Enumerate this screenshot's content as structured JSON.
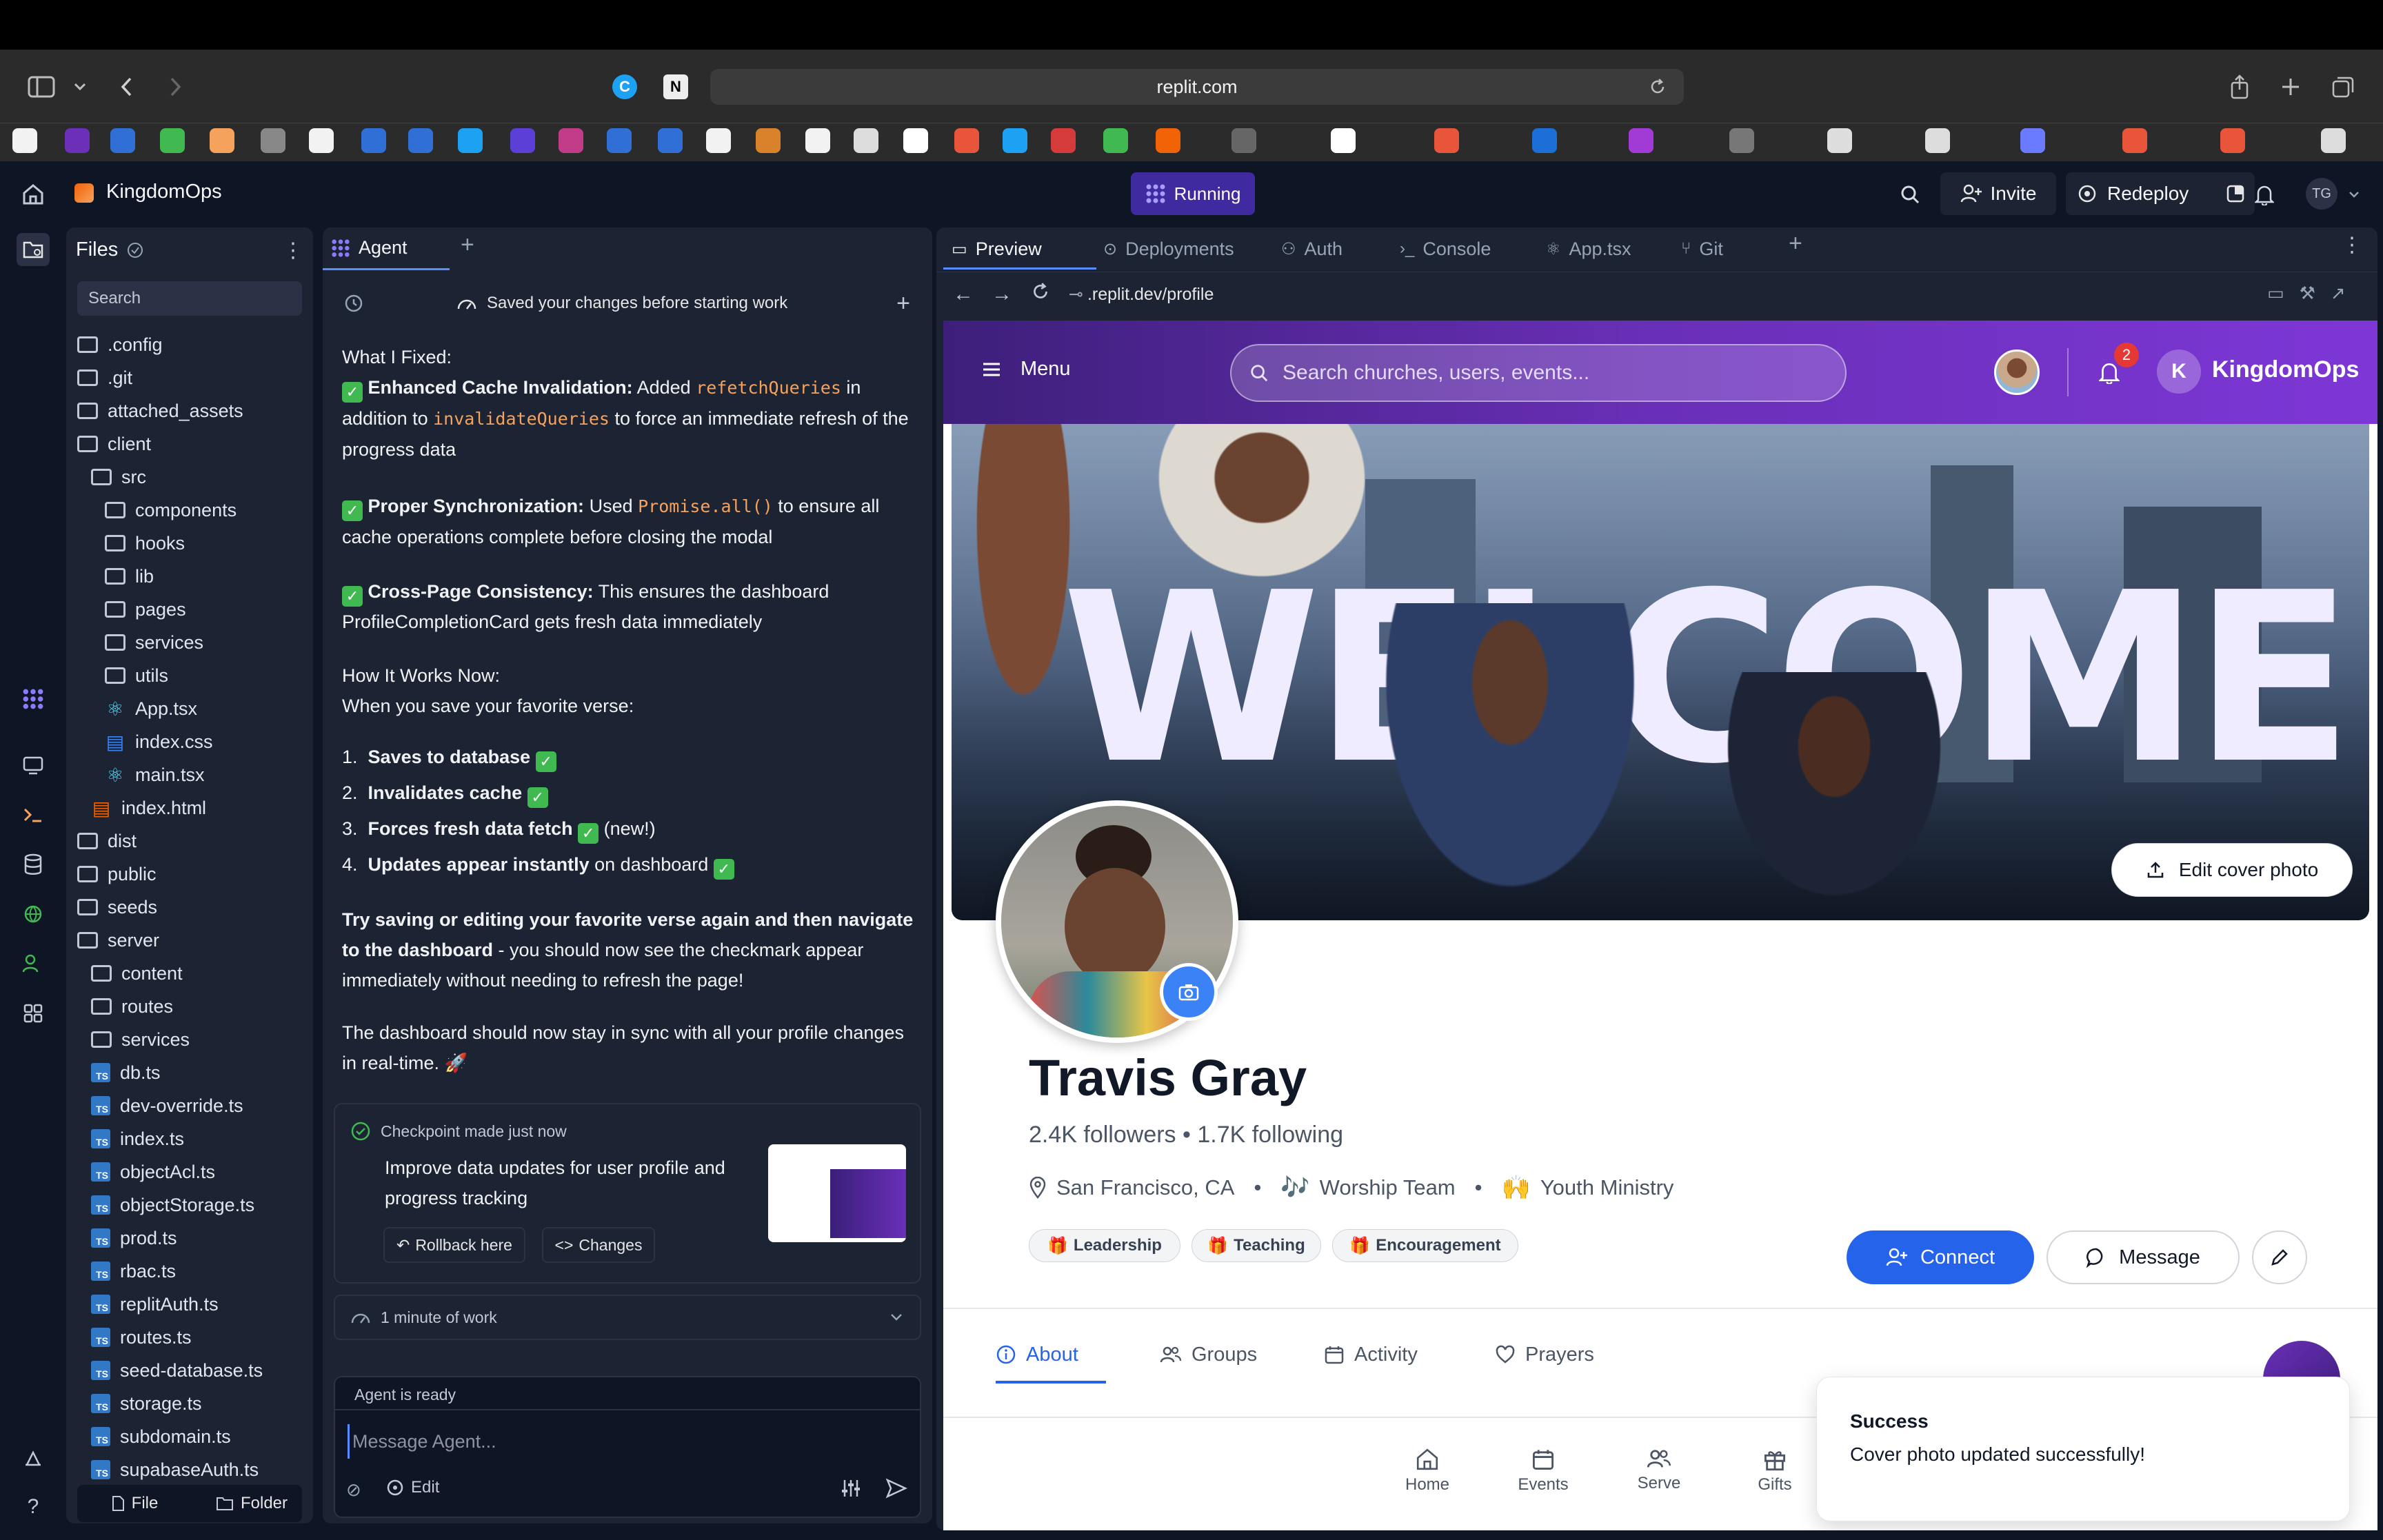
{
  "browser": {
    "url": "replit.com"
  },
  "replit": {
    "repl_name": "KingdomOps",
    "status": "Running",
    "invite_label": "Invite",
    "redeploy_label": "Redeploy",
    "user_initials": "TG"
  },
  "files_panel": {
    "title": "Files",
    "search_placeholder": "Search",
    "items": [
      {
        "name": ".config",
        "type": "folder",
        "depth": 0
      },
      {
        "name": ".git",
        "type": "folder",
        "depth": 0
      },
      {
        "name": "attached_assets",
        "type": "folder",
        "depth": 0
      },
      {
        "name": "client",
        "type": "folder-open",
        "depth": 0
      },
      {
        "name": "src",
        "type": "folder-open",
        "depth": 1
      },
      {
        "name": "components",
        "type": "folder",
        "depth": 2
      },
      {
        "name": "hooks",
        "type": "folder",
        "depth": 2
      },
      {
        "name": "lib",
        "type": "folder",
        "depth": 2
      },
      {
        "name": "pages",
        "type": "folder",
        "depth": 2
      },
      {
        "name": "services",
        "type": "folder",
        "depth": 2
      },
      {
        "name": "utils",
        "type": "folder",
        "depth": 2
      },
      {
        "name": "App.tsx",
        "type": "react",
        "depth": 2
      },
      {
        "name": "index.css",
        "type": "css",
        "depth": 2
      },
      {
        "name": "main.tsx",
        "type": "react",
        "depth": 2
      },
      {
        "name": "index.html",
        "type": "html",
        "depth": 1
      },
      {
        "name": "dist",
        "type": "folder",
        "depth": 0
      },
      {
        "name": "public",
        "type": "folder",
        "depth": 0
      },
      {
        "name": "seeds",
        "type": "folder",
        "depth": 0
      },
      {
        "name": "server",
        "type": "folder-open",
        "depth": 0
      },
      {
        "name": "content",
        "type": "folder",
        "depth": 1
      },
      {
        "name": "routes",
        "type": "folder",
        "depth": 1
      },
      {
        "name": "services",
        "type": "folder",
        "depth": 1
      },
      {
        "name": "db.ts",
        "type": "ts",
        "depth": 1
      },
      {
        "name": "dev-override.ts",
        "type": "ts",
        "depth": 1
      },
      {
        "name": "index.ts",
        "type": "ts",
        "depth": 1
      },
      {
        "name": "objectAcl.ts",
        "type": "ts",
        "depth": 1
      },
      {
        "name": "objectStorage.ts",
        "type": "ts",
        "depth": 1
      },
      {
        "name": "prod.ts",
        "type": "ts",
        "depth": 1
      },
      {
        "name": "rbac.ts",
        "type": "ts",
        "depth": 1
      },
      {
        "name": "replitAuth.ts",
        "type": "ts",
        "depth": 1
      },
      {
        "name": "routes.ts",
        "type": "ts",
        "depth": 1
      },
      {
        "name": "seed-database.ts",
        "type": "ts",
        "depth": 1
      },
      {
        "name": "storage.ts",
        "type": "ts",
        "depth": 1
      },
      {
        "name": "subdomain.ts",
        "type": "ts",
        "depth": 1
      },
      {
        "name": "supabaseAuth.ts",
        "type": "ts",
        "depth": 1
      }
    ],
    "file_button": "File",
    "folder_button": "Folder"
  },
  "agent": {
    "tab_label": "Agent",
    "saved_banner": "Saved your changes before starting work",
    "heading_fixed": "What I Fixed:",
    "p1_bold": "Enhanced Cache Invalidation:",
    "p1_a": " Added ",
    "p1_code1": "refetchQueries",
    "p1_b": " in addition to ",
    "p1_code2": "invalidateQueries",
    "p1_c": " to force an immediate refresh of the progress data",
    "p2_bold": "Proper Synchronization:",
    "p2_a": " Used ",
    "p2_code": "Promise.all()",
    "p2_b": " to ensure all cache operations complete before closing the modal",
    "p3_bold": "Cross-Page Consistency:",
    "p3_a": " This ensures the dashboard ProfileCompletionCard gets fresh data immediately",
    "how_heading": "How It Works Now:",
    "how_sub": "When you save your favorite verse:",
    "step1": "Saves to database",
    "step2": "Invalidates cache",
    "step3": "Forces fresh data fetch",
    "step3_suffix": "(new!)",
    "step4": "Updates appear instantly",
    "step4_suffix": "on dashboard",
    "try_bold": "Try saving or editing your favorite verse again and then navigate to the dashboard",
    "try_rest": " - you should now see the checkmark appear immediately without needing to refresh the page!",
    "closing": "The dashboard should now stay in sync with all your profile changes in real-time. 🚀",
    "checkpoint_title": "Checkpoint made just now",
    "checkpoint_desc": "Improve data updates for user profile and progress tracking",
    "rollback_label": "Rollback here",
    "changes_label": "Changes",
    "work_time": "1 minute of work",
    "ready_label": "Agent is ready",
    "input_placeholder": "Message Agent...",
    "edit_label": "Edit"
  },
  "preview_tabs": {
    "tabs": [
      "Preview",
      "Deployments",
      "Auth",
      "Console",
      "App.tsx",
      "Git"
    ],
    "url": ".replit.dev/profile"
  },
  "app": {
    "menu_label": "Menu",
    "search_placeholder": "Search churches, users, events...",
    "notification_count": "2",
    "brand_initial": "K",
    "brand_name": "KingdomOps",
    "cover_word": "WELCOME",
    "edit_cover_label": "Edit cover photo",
    "profile": {
      "name": "Travis Gray",
      "followers": "2.4K followers • 1.7K following",
      "location": "San Francisco, CA",
      "team": "Worship Team",
      "ministry": "Youth Ministry",
      "chips": [
        "Leadership",
        "Teaching",
        "Encouragement"
      ]
    },
    "connect_label": "Connect",
    "message_label": "Message",
    "tabs": [
      "About",
      "Groups",
      "Activity",
      "Prayers"
    ],
    "bottom_nav": [
      "Home",
      "Events",
      "Serve",
      "Gifts"
    ],
    "toast": {
      "title": "Success",
      "message": "Cover photo updated successfully!"
    }
  },
  "colors": {
    "replit_bg": "#0e1525",
    "panel_bg": "#1c2333",
    "accent_purple": "#5b3fd6",
    "connect_blue": "#2563eb",
    "check_green": "#3fb950"
  }
}
